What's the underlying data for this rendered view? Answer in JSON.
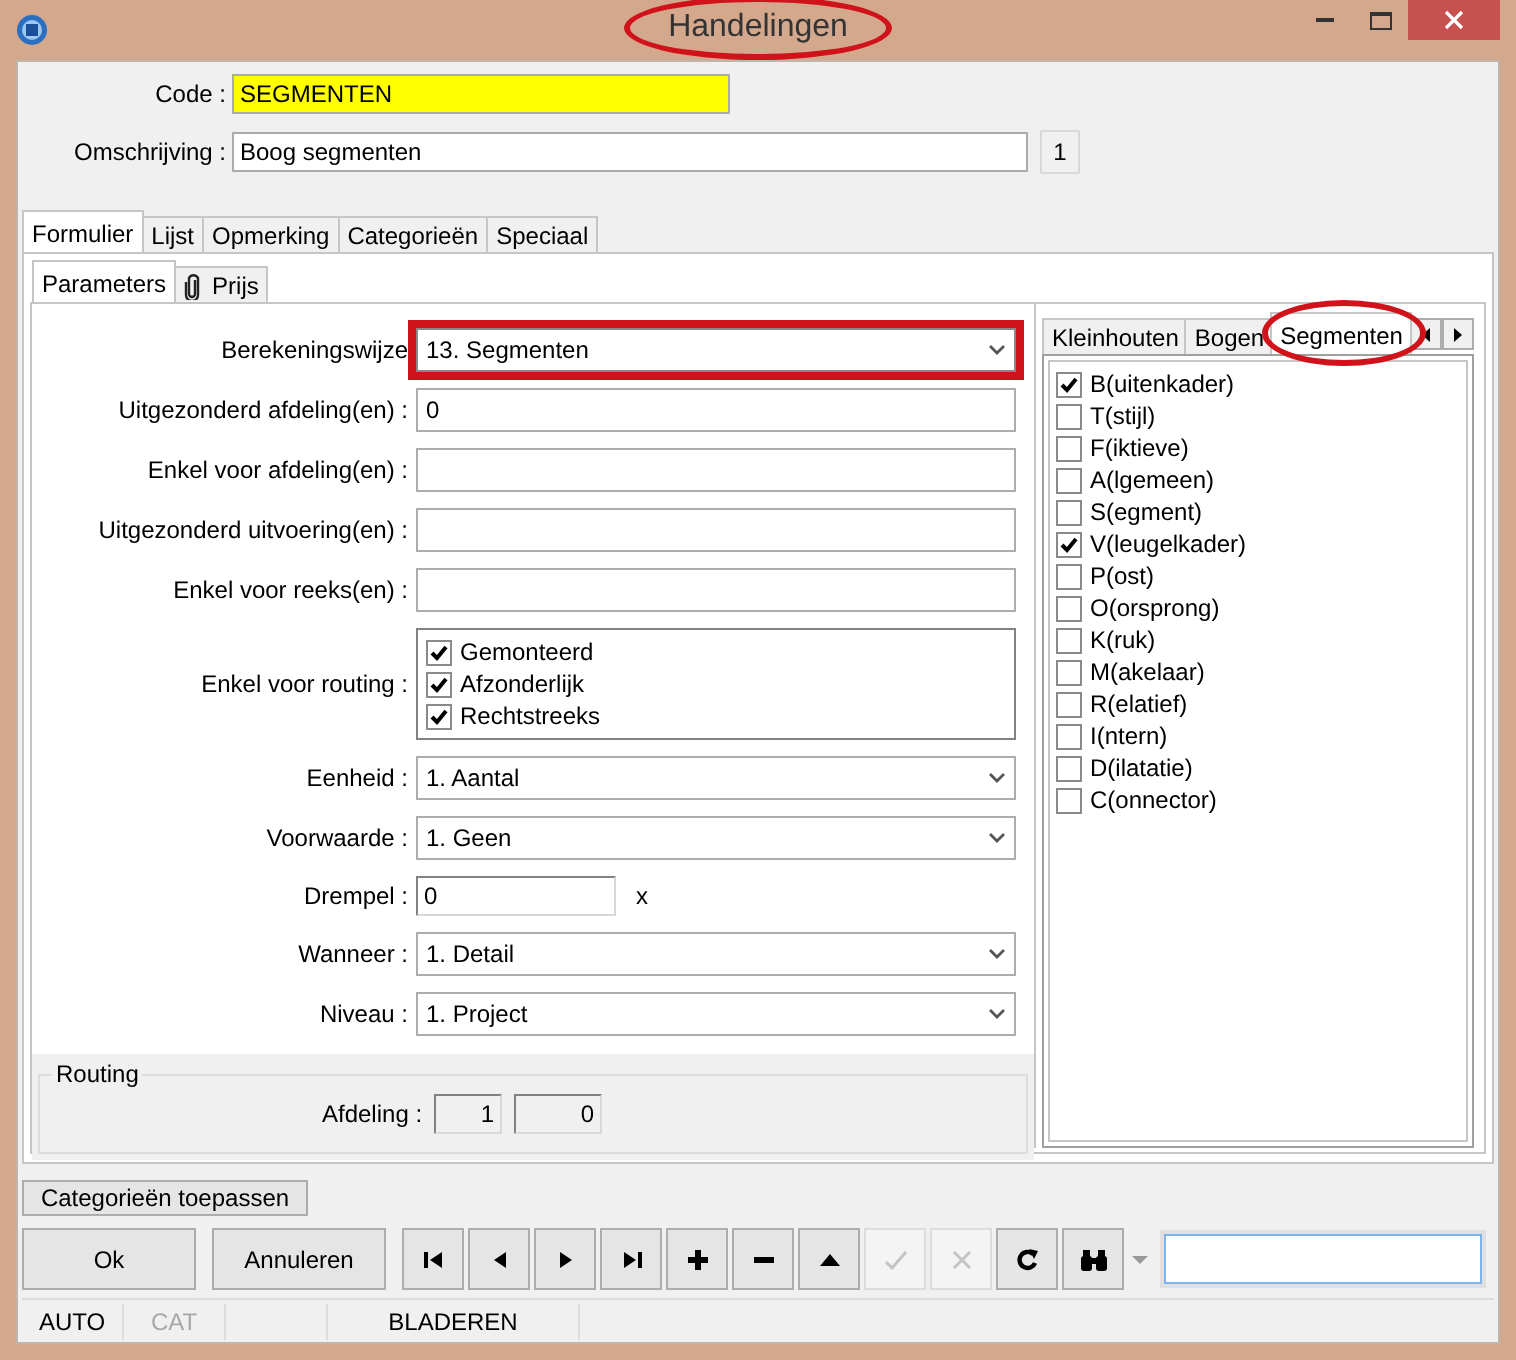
{
  "window": {
    "title": "Handelingen",
    "highlighted": true
  },
  "header": {
    "code": {
      "label": "Code :",
      "value": "SEGMENTEN"
    },
    "description": {
      "label": "Omschrijving :",
      "value": "Boog segmenten",
      "counter": "1"
    }
  },
  "tabs": [
    {
      "label": "Formulier",
      "selected": true
    },
    {
      "label": "Lijst",
      "selected": false
    },
    {
      "label": "Opmerking",
      "selected": false
    },
    {
      "label": "Categorieën",
      "selected": false
    },
    {
      "label": "Speciaal",
      "selected": false
    }
  ],
  "subtabs": [
    {
      "label": "Parameters",
      "selected": true,
      "kind": "plain"
    },
    {
      "label": "Prijs",
      "selected": false,
      "kind": "attachment"
    }
  ],
  "form": [
    {
      "kind": "select",
      "label": "Berekeningswijze",
      "value": "13. Segmenten",
      "highlighted": true
    },
    {
      "kind": "text",
      "label": "Uitgezonderd afdeling(en) :",
      "value": "0"
    },
    {
      "kind": "text",
      "label": "Enkel voor afdeling(en) :"
    },
    {
      "kind": "text",
      "label": "Uitgezonderd uitvoering(en) :"
    },
    {
      "kind": "text",
      "label": "Enkel voor reeks(en) :"
    },
    {
      "kind": "checklist",
      "label": "Enkel voor routing :",
      "items": [
        {
          "label": "Gemonteerd",
          "checked": true
        },
        {
          "label": "Afzonderlijk",
          "checked": true
        },
        {
          "label": "Rechtstreeks",
          "checked": true
        }
      ]
    },
    {
      "kind": "select",
      "label": "Eenheid :",
      "value": "1.  Aantal",
      "highlighted": false
    },
    {
      "kind": "select",
      "label": "Voorwaarde :",
      "value": "1.  Geen",
      "highlighted": false
    },
    {
      "kind": "short",
      "label": "Drempel :",
      "value": "0",
      "suffix": "x"
    },
    {
      "kind": "select",
      "label": "Wanneer :",
      "value": "1.  Detail",
      "highlighted": false
    },
    {
      "kind": "select",
      "label": "Niveau :",
      "value": "1.  Project",
      "highlighted": false
    }
  ],
  "routing": {
    "title": "Routing",
    "label": "Afdeling :",
    "values": [
      "1",
      "0"
    ]
  },
  "side_panel": {
    "tabs": [
      {
        "label": "Kleinhouten",
        "selected": false,
        "highlighted": false
      },
      {
        "label": "Bogen",
        "selected": false,
        "highlighted": false
      },
      {
        "label": "Segmenten",
        "selected": true,
        "highlighted": true
      }
    ],
    "items": [
      {
        "label": "B(uitenkader)",
        "checked": true
      },
      {
        "label": "T(stijl)",
        "checked": false
      },
      {
        "label": "F(iktieve)",
        "checked": false
      },
      {
        "label": "A(lgemeen)",
        "checked": false
      },
      {
        "label": "S(egment)",
        "checked": false
      },
      {
        "label": "V(leugelkader)",
        "checked": true
      },
      {
        "label": "P(ost)",
        "checked": false
      },
      {
        "label": "O(orsprong)",
        "checked": false
      },
      {
        "label": "K(ruk)",
        "checked": false
      },
      {
        "label": "M(akelaar)",
        "checked": false
      },
      {
        "label": "R(elatief)",
        "checked": false
      },
      {
        "label": "I(ntern)",
        "checked": false
      },
      {
        "label": "D(ilatatie)",
        "checked": false
      },
      {
        "label": "C(onnector)",
        "checked": false
      }
    ]
  },
  "apply_button": "Categorieën toepassen",
  "buttons": [
    "Ok",
    "Annuleren"
  ],
  "toolbar": [
    {
      "kind": "first",
      "disabled": false
    },
    {
      "kind": "previous",
      "disabled": false
    },
    {
      "kind": "next",
      "disabled": false
    },
    {
      "kind": "last",
      "disabled": false
    },
    {
      "kind": "add",
      "disabled": false
    },
    {
      "kind": "remove",
      "disabled": false
    },
    {
      "kind": "up",
      "disabled": false
    },
    {
      "kind": "confirm",
      "disabled": true
    },
    {
      "kind": "cancel",
      "disabled": true
    },
    {
      "kind": "refresh",
      "disabled": false
    },
    {
      "kind": "find",
      "disabled": false
    }
  ],
  "status_bar": [
    {
      "text": "AUTO",
      "disabled": false
    },
    {
      "text": "CAT",
      "disabled": true
    },
    {
      "text": "BLADEREN",
      "disabled": false
    }
  ]
}
